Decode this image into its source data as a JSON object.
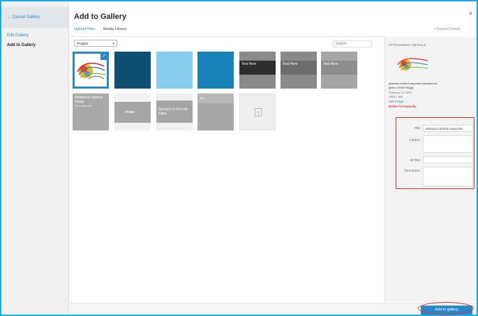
{
  "sidebar": {
    "cancel_label": "← Cancel Gallery",
    "items": [
      {
        "label": "Edit Gallery",
        "active": false
      },
      {
        "label": "Add to Gallery",
        "active": true
      }
    ]
  },
  "header": {
    "title": "Add to Gallery",
    "close_symbol": "×",
    "top_right_link": "▾ Expand Details"
  },
  "tabs": [
    {
      "label": "Upload Files",
      "active": true
    },
    {
      "label": "Media Library",
      "active": false
    }
  ],
  "filter": {
    "selected": "Images",
    "caret": "▾"
  },
  "search": {
    "placeholder": "Search"
  },
  "grid": {
    "items": [
      {
        "kind": "artwork",
        "selected": true,
        "check": "✓",
        "color": "#ffffff"
      },
      {
        "kind": "solid",
        "color": "#0d4f73"
      },
      {
        "kind": "solid",
        "color": "#87cdf0"
      },
      {
        "kind": "solid",
        "color": "#1782b7"
      },
      {
        "kind": "banded",
        "color": "#8a8a8a",
        "text": "Text Here"
      },
      {
        "kind": "banded",
        "color": "#8a8a8a",
        "text": "Text Here"
      },
      {
        "kind": "banded",
        "color": "#a5a5a5",
        "text": "Text Here"
      },
      {
        "kind": "text",
        "color": "#a9a9a9",
        "text": "Additional Sidebar Image",
        "sub": "For header note"
      },
      {
        "kind": "text",
        "color": "#a6a6a6",
        "text": "Image"
      },
      {
        "kind": "text",
        "color": "#a5a5a5",
        "text": "Sponsor or Accred. logos"
      },
      {
        "kind": "text",
        "color": "#a8a8a8",
        "text": "Text"
      },
      {
        "kind": "document",
        "color": "#efefef"
      }
    ]
  },
  "details": {
    "heading": "ATTACHMENT DETAILS",
    "filename_line1": "abstract-colorful-corporate-background-",
    "filename_line2": "globe-19185796.jpg",
    "date": "February 23, 2015",
    "dimensions": "1300 × 960",
    "edit_link": "Edit Image",
    "delete_link": "Delete Permanently",
    "fields": {
      "title_label": "Title",
      "title_value": "abstract-colorful-corporate-",
      "caption_label": "Caption",
      "alt_label": "Alt Text",
      "description_label": "Description"
    }
  },
  "footer": {
    "add_button": "Add to gallery"
  },
  "colors": {
    "accent": "#2b88c6",
    "frame": "#17a9e6",
    "highlight": "#dd3333"
  }
}
